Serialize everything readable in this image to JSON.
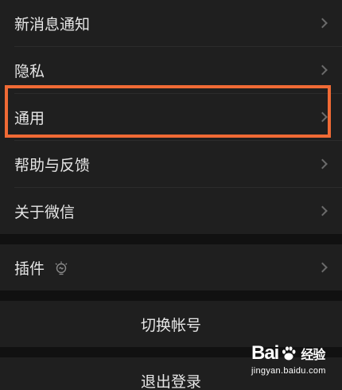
{
  "settings": {
    "items": [
      {
        "label": "新消息通知"
      },
      {
        "label": "隐私"
      },
      {
        "label": "通用"
      },
      {
        "label": "帮助与反馈"
      },
      {
        "label": "关于微信"
      }
    ],
    "plugins": {
      "label": "插件"
    },
    "switch_account": "切换帐号",
    "logout": "退出登录"
  },
  "watermark": {
    "brand_a": "Bai",
    "brand_b": "经验",
    "url": "jingyan.baidu.com"
  },
  "colors": {
    "highlight": "#f06a35",
    "background": "#111111",
    "row": "#1f1f1f"
  }
}
